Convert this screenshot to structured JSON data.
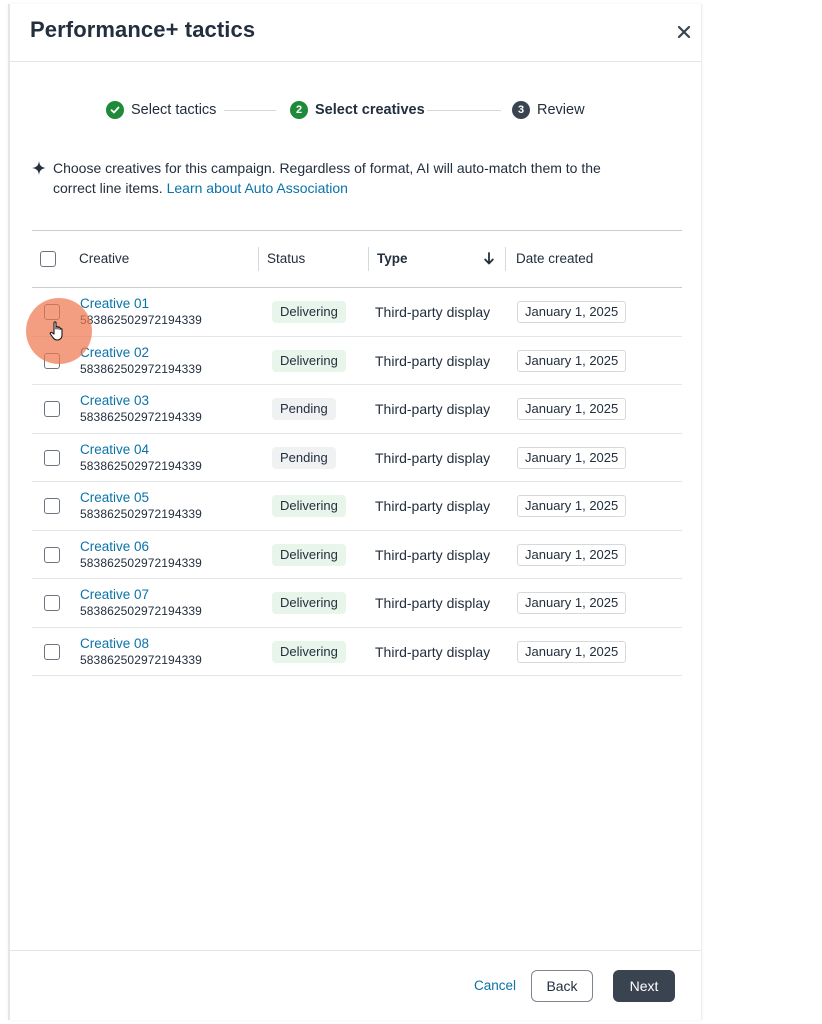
{
  "modal": {
    "title": "Performance+ tactics",
    "close_icon": "close-icon"
  },
  "stepper": {
    "steps": [
      {
        "number": "1",
        "label": "Select tactics",
        "state": "complete",
        "color": "#1e8a3a"
      },
      {
        "number": "2",
        "label": "Select creatives",
        "state": "current",
        "color": "#1e8a3a"
      },
      {
        "number": "3",
        "label": "Review",
        "state": "upcoming",
        "color": "#3a4350"
      }
    ]
  },
  "info": {
    "icon": "sparkle-icon",
    "text": "Choose creatives for this campaign. Regardless of format, AI will auto-match them to the correct line items.",
    "link": "Learn about Auto Association"
  },
  "table": {
    "headers": {
      "creative": "Creative",
      "status": "Status",
      "type": "Type",
      "date": "Date created"
    },
    "sort_icon": "arrow-down-icon",
    "rows": [
      {
        "name": "Creative 01",
        "id": "583862502972194339",
        "status": "Delivering",
        "type": "Third-party display",
        "date": "January 1, 2025"
      },
      {
        "name": "Creative 02",
        "id": "583862502972194339",
        "status": "Delivering",
        "type": "Third-party display",
        "date": "January 1, 2025"
      },
      {
        "name": "Creative 03",
        "id": "583862502972194339",
        "status": "Pending",
        "type": "Third-party display",
        "date": "January 1, 2025"
      },
      {
        "name": "Creative 04",
        "id": "583862502972194339",
        "status": "Pending",
        "type": "Third-party display",
        "date": "January 1, 2025"
      },
      {
        "name": "Creative 05",
        "id": "583862502972194339",
        "status": "Delivering",
        "type": "Third-party display",
        "date": "January 1, 2025"
      },
      {
        "name": "Creative 06",
        "id": "583862502972194339",
        "status": "Delivering",
        "type": "Third-party display",
        "date": "January 1, 2025"
      },
      {
        "name": "Creative 07",
        "id": "583862502972194339",
        "status": "Delivering",
        "type": "Third-party display",
        "date": "January 1, 2025"
      },
      {
        "name": "Creative 08",
        "id": "583862502972194339",
        "status": "Delivering",
        "type": "Third-party display",
        "date": "January 1, 2025"
      }
    ]
  },
  "footer": {
    "cancel_label": "Cancel",
    "back_label": "Back",
    "next_label": "Next"
  },
  "colors": {
    "link": "#0a73a8",
    "success": "#1e8a3a",
    "primary_button": "#3a4350",
    "delivering_badge": "#e8f5ea",
    "pending_badge": "#f0f1f2",
    "cursor_highlight": "#f07850"
  }
}
